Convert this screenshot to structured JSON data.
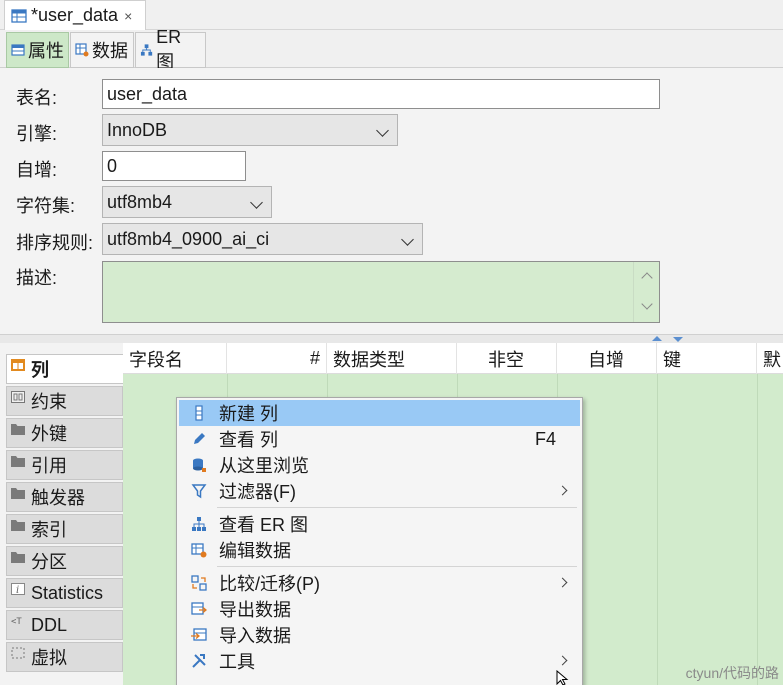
{
  "editor_tab": {
    "title": "*user_data",
    "close": "×"
  },
  "sub_tabs": [
    {
      "label": "属性"
    },
    {
      "label": "数据"
    },
    {
      "label": "ER 图"
    }
  ],
  "form": {
    "table_name_label": "表名:",
    "table_name_value": "user_data",
    "engine_label": "引擎:",
    "engine_value": "InnoDB",
    "auto_inc_label": "自增:",
    "auto_inc_value": "0",
    "charset_label": "字符集:",
    "charset_value": "utf8mb4",
    "collation_label": "排序规则:",
    "collation_value": "utf8mb4_0900_ai_ci",
    "description_label": "描述:",
    "description_value": ""
  },
  "vnav": {
    "items": [
      {
        "label": "列",
        "icon": "columns-icon"
      },
      {
        "label": "约束",
        "icon": "constraint-icon"
      },
      {
        "label": "外键",
        "icon": "folder-icon"
      },
      {
        "label": "引用",
        "icon": "folder-icon"
      },
      {
        "label": "触发器",
        "icon": "folder-icon"
      },
      {
        "label": "索引",
        "icon": "folder-icon"
      },
      {
        "label": "分区",
        "icon": "folder-icon"
      },
      {
        "label": "Statistics",
        "icon": "info-icon"
      },
      {
        "label": "DDL",
        "icon": "ddl-icon"
      },
      {
        "label": "虚拟",
        "icon": "virtual-icon"
      }
    ]
  },
  "grid": {
    "columns": [
      "字段名",
      "#",
      "数据类型",
      "非空",
      "自增",
      "键",
      "默"
    ]
  },
  "context_menu": {
    "items": [
      {
        "label": "新建 列",
        "icon": "new-column-icon",
        "shortcut": "",
        "submenu": false
      },
      {
        "label": "查看 列",
        "icon": "edit-pencil-icon",
        "shortcut": "F4",
        "submenu": false
      },
      {
        "label": "从这里浏览",
        "icon": "database-browse-icon",
        "shortcut": "",
        "submenu": false
      },
      {
        "label": "过滤器(F)",
        "icon": "filter-icon",
        "shortcut": "",
        "submenu": true
      },
      {
        "label": "查看 ER 图",
        "icon": "er-diagram-icon",
        "shortcut": "",
        "submenu": false
      },
      {
        "label": "编辑数据",
        "icon": "edit-data-icon",
        "shortcut": "",
        "submenu": false
      },
      {
        "label": "比较/迁移(P)",
        "icon": "compare-icon",
        "shortcut": "",
        "submenu": true
      },
      {
        "label": "导出数据",
        "icon": "export-icon",
        "shortcut": "",
        "submenu": false
      },
      {
        "label": "导入数据",
        "icon": "import-icon",
        "shortcut": "",
        "submenu": false
      },
      {
        "label": "工具",
        "icon": "tools-icon",
        "shortcut": "",
        "submenu": true
      }
    ]
  },
  "watermark": "ctyun/代码的路",
  "colors": {
    "accent_green": "#cde8c8",
    "menu_highlight": "#99c9f5",
    "grid_bg": "#d2ebcc"
  }
}
